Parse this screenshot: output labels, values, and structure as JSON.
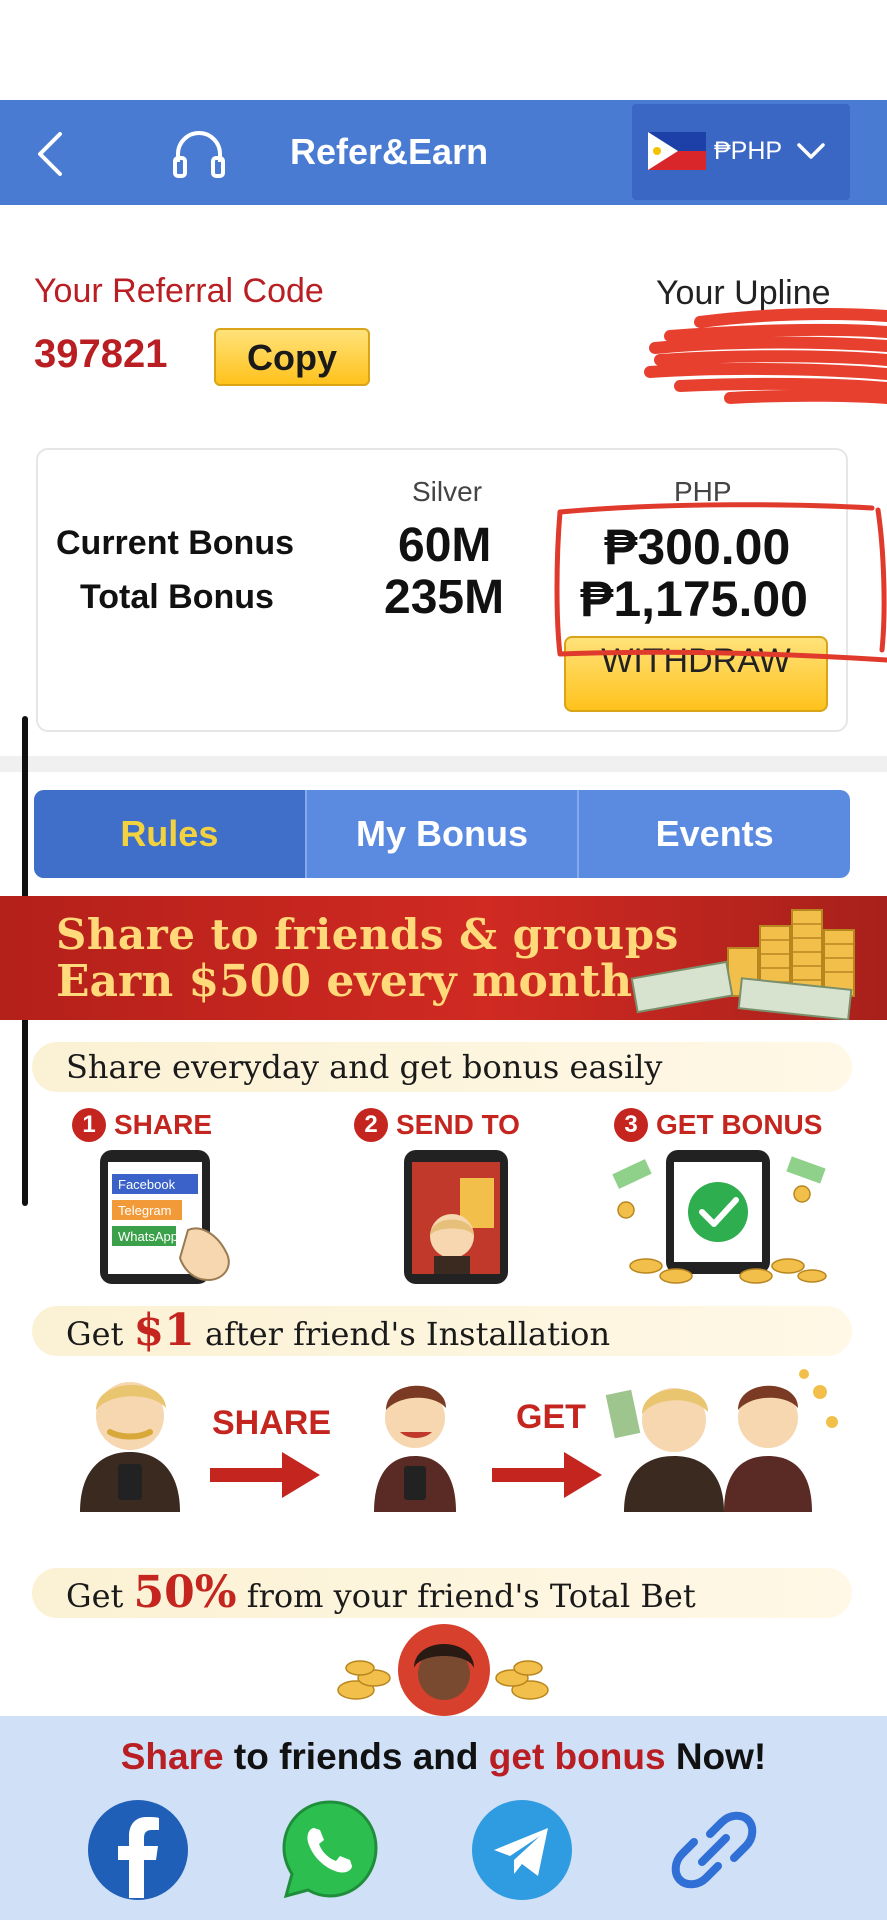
{
  "header": {
    "title": "Refer&Earn",
    "currency_label": "₱PHP",
    "colors": {
      "bar": "#4a7bd2",
      "currency_box": "#3b67c4"
    }
  },
  "referral": {
    "label": "Your Referral Code",
    "code": "397821",
    "copy_label": "Copy",
    "upline_label": "Your Upline"
  },
  "bonus": {
    "silver_header": "Silver",
    "php_header": "PHP",
    "current_label": "Current Bonus",
    "total_label": "Total Bonus",
    "current_silver": "60M",
    "total_silver": "235M",
    "current_php": "₱300.00",
    "total_php": "₱1,175.00",
    "withdraw_label": "WITHDRAW"
  },
  "tabs": [
    {
      "label": "Rules",
      "active": true
    },
    {
      "label": "My Bonus",
      "active": false
    },
    {
      "label": "Events",
      "active": false
    }
  ],
  "banner": {
    "line1": "Share to friends & groups",
    "line2": "Earn $500 every month"
  },
  "rules": {
    "pill1": "Share everyday and get bonus easily",
    "steps": [
      {
        "num": "1",
        "label": "SHARE"
      },
      {
        "num": "2",
        "label": "SEND TO"
      },
      {
        "num": "3",
        "label": "GET BONUS"
      }
    ],
    "phone_apps": [
      "Facebook",
      "Telegram",
      "WhatsApp"
    ],
    "pill2_pre": "Get ",
    "pill2_big": "$1",
    "pill2_post": " after friend's Installation",
    "share_arrow_label": "SHARE",
    "get_arrow_label": "GET",
    "pill3_pre": "Get ",
    "pill3_big": "50%",
    "pill3_post": " from your friend's Total Bet"
  },
  "footer": {
    "text_red1": "Share",
    "text_mid": " to friends and ",
    "text_red2": "get bonus",
    "text_end": " Now!",
    "icons": [
      "facebook-icon",
      "whatsapp-icon",
      "telegram-icon",
      "link-icon"
    ]
  }
}
